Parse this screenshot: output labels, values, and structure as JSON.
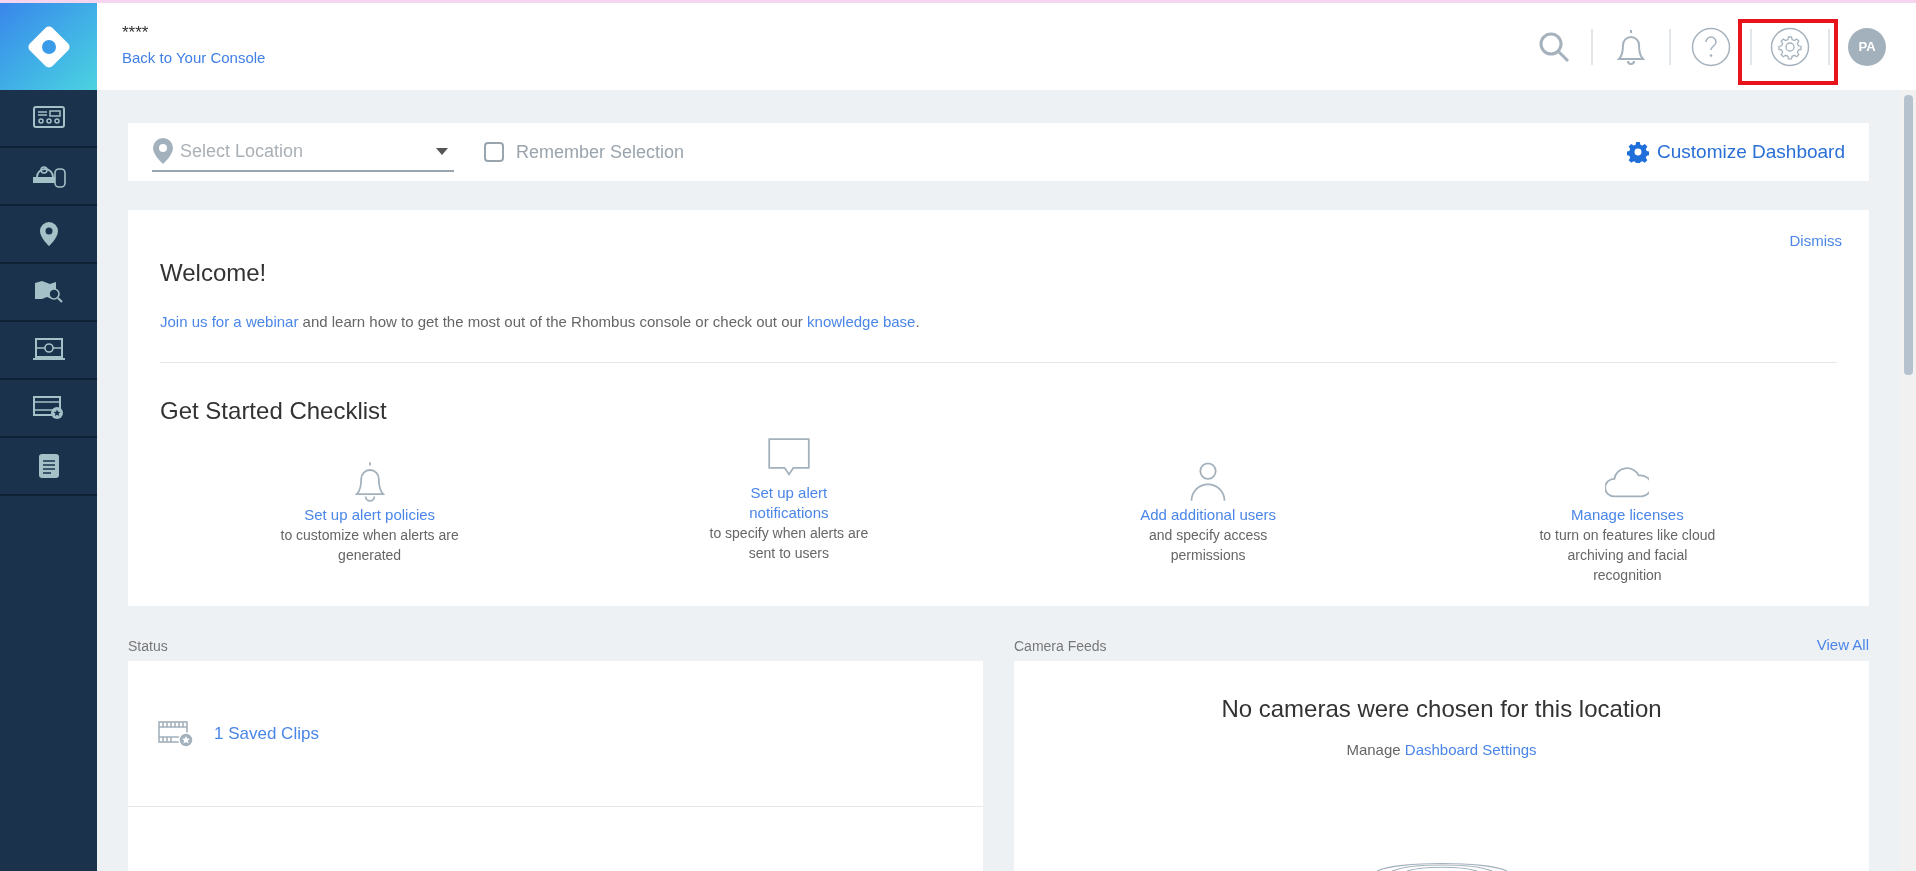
{
  "header": {
    "title": "****",
    "back_link": "Back to Your Console",
    "avatar": "PA"
  },
  "toolbar": {
    "location_placeholder": "Select Location",
    "remember": {
      "label": "Remember Selection",
      "checked": false
    },
    "customize": "Customize Dashboard"
  },
  "welcome": {
    "dismiss": "Dismiss",
    "title": "Welcome!",
    "message": [
      {
        "kind": "link",
        "text": "Join us for a webinar"
      },
      {
        "kind": "text",
        "text": " and learn how to get the most out of the Rhombus console or check out our "
      },
      {
        "kind": "link",
        "text": "knowledge base"
      },
      {
        "kind": "text",
        "text": "."
      }
    ],
    "checklist_title": "Get Started Checklist",
    "checklist": [
      {
        "kind": "bell",
        "title": "Set up alert policies",
        "description": "to customize when alerts are generated"
      },
      {
        "kind": "chat",
        "title": "Set up alert notifications",
        "description": "to specify when alerts are sent to users"
      },
      {
        "kind": "user",
        "title": "Add additional users",
        "description": "and specify access permissions"
      },
      {
        "kind": "cloud",
        "title": "Manage licenses",
        "description": "to turn on features like cloud archiving and facial recognition"
      }
    ]
  },
  "status": {
    "label": "Status",
    "saved_clips": "1 Saved Clips"
  },
  "camera_feeds": {
    "label": "Camera Feeds",
    "view_all": "View All",
    "empty": "No cameras were chosen for this location",
    "manage": "Manage",
    "settings_link": "Dashboard Settings"
  }
}
